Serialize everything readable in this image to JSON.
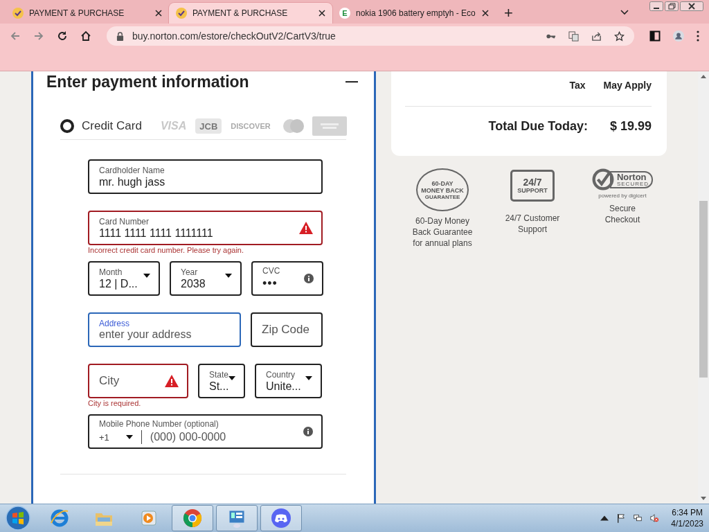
{
  "browser": {
    "tabs": [
      {
        "title": "PAYMENT & PURCHASE",
        "selected": false,
        "favicon": {
          "kind": "check"
        }
      },
      {
        "title": "PAYMENT & PURCHASE",
        "selected": true,
        "favicon": {
          "kind": "check"
        }
      },
      {
        "title": "nokia 1906 battery emptyh - Eco",
        "selected": false,
        "favicon": {
          "kind": "letter",
          "text": "E"
        }
      }
    ],
    "new_tab": "+",
    "url": "buy.norton.com/estore/checkOutV2/CartV3/true"
  },
  "payment": {
    "heading": "Enter payment information",
    "method": {
      "label": "Credit Card",
      "selected": true
    },
    "card_logos": [
      {
        "kind": "visa",
        "text": "VISA"
      },
      {
        "kind": "jcb",
        "text": "JCB"
      },
      {
        "kind": "discover",
        "text": "DISCOVER"
      },
      {
        "kind": "mastercard"
      },
      {
        "kind": "amex"
      }
    ],
    "rows": [
      {
        "fields": [
          {
            "kind": "text",
            "label": "Cardholder Name",
            "value": "mr. hugh jass",
            "invalid": false,
            "focused": false
          }
        ]
      },
      {
        "fields": [
          {
            "kind": "text",
            "label": "Card Number",
            "value": "1111 1111 1111 1111111",
            "invalid": true,
            "focused": false
          }
        ],
        "error": "Incorrect credit card number. Please try again."
      },
      {
        "fields": [
          {
            "kind": "select",
            "label": "Month",
            "value": "12 | D...",
            "invalid": false,
            "focused": false
          },
          {
            "kind": "select",
            "label": "Year",
            "value": "2038",
            "invalid": false,
            "focused": false
          },
          {
            "kind": "secret",
            "label": "CVC",
            "value": "•••",
            "invalid": false,
            "focused": false
          }
        ]
      },
      {
        "fields": [
          {
            "kind": "text",
            "label": "Address",
            "placeholder": "enter your address",
            "invalid": false,
            "focused": true
          },
          {
            "kind": "text",
            "placeholder": "Zip Code",
            "invalid": false,
            "focused": false
          }
        ]
      },
      {
        "fields": [
          {
            "kind": "text",
            "placeholder": "City",
            "invalid": true,
            "focused": false
          },
          {
            "kind": "select",
            "label": "State",
            "value": "St...",
            "invalid": false,
            "focused": false
          },
          {
            "kind": "select",
            "label": "Country",
            "value": "Unite...",
            "invalid": false,
            "focused": false
          }
        ],
        "error": "City is required."
      },
      {
        "fields": [
          {
            "kind": "phone",
            "label": "Mobile Phone Number (optional)",
            "code": "+1",
            "placeholder": "(000) 000-0000",
            "invalid": false,
            "focused": false
          }
        ]
      }
    ]
  },
  "summary": {
    "lines": [
      {
        "label": "Tax",
        "value": "May Apply"
      }
    ],
    "total": {
      "label": "Total Due Today:",
      "value": "$ 19.99"
    }
  },
  "badges": [
    {
      "kind": "money_back",
      "icon_texts": [
        "60-DAY",
        "MONEY BACK",
        "GUARANTEE"
      ],
      "lines": [
        "60-Day Money",
        "Back Guarantee",
        "for annual plans"
      ]
    },
    {
      "kind": "support",
      "icon_texts": [
        "24/7",
        "SUPPORT"
      ],
      "lines": [
        "24/7 Customer",
        "Support"
      ]
    },
    {
      "kind": "norton",
      "icon_texts": [
        "Norton",
        "SECURED",
        "powered by digicert"
      ],
      "lines": [
        "Secure",
        "Checkout"
      ]
    }
  ],
  "taskbar": {
    "apps": [
      {
        "kind": "ie",
        "selected": false
      },
      {
        "kind": "explorer",
        "selected": false
      },
      {
        "kind": "media",
        "selected": false
      },
      {
        "kind": "chrome",
        "selected": true
      },
      {
        "kind": "control",
        "selected": true
      },
      {
        "kind": "discord",
        "selected": true
      }
    ],
    "time": "6:34 PM",
    "date": "4/1/2023"
  }
}
